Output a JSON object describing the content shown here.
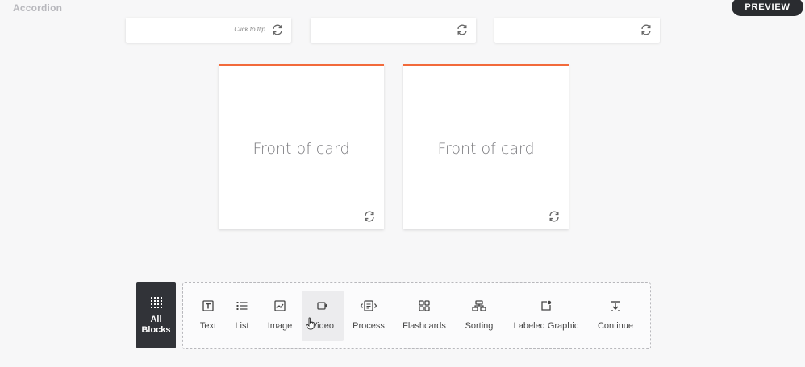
{
  "header": {
    "title": "Accordion",
    "preview_label": "PREVIEW"
  },
  "top_cards": [
    {
      "hint": "Click to flip"
    },
    {
      "hint": ""
    },
    {
      "hint": ""
    }
  ],
  "cards": [
    {
      "front": "Front of card"
    },
    {
      "front": "Front of card"
    }
  ],
  "colors": {
    "accent": "#f26a3b",
    "dark": "#313338",
    "background": "#f7f7f8"
  },
  "toolbar": {
    "all_blocks_label": "All\nBlocks",
    "items": [
      {
        "label": "Text",
        "icon": "text-icon"
      },
      {
        "label": "List",
        "icon": "list-icon"
      },
      {
        "label": "Image",
        "icon": "image-icon"
      },
      {
        "label": "Video",
        "icon": "video-icon",
        "selected": true
      },
      {
        "label": "Process",
        "icon": "process-icon"
      },
      {
        "label": "Flashcards",
        "icon": "flashcards-icon"
      },
      {
        "label": "Sorting",
        "icon": "sorting-icon"
      },
      {
        "label": "Labeled Graphic",
        "icon": "labeled-graphic-icon"
      },
      {
        "label": "Continue",
        "icon": "continue-icon"
      }
    ]
  }
}
